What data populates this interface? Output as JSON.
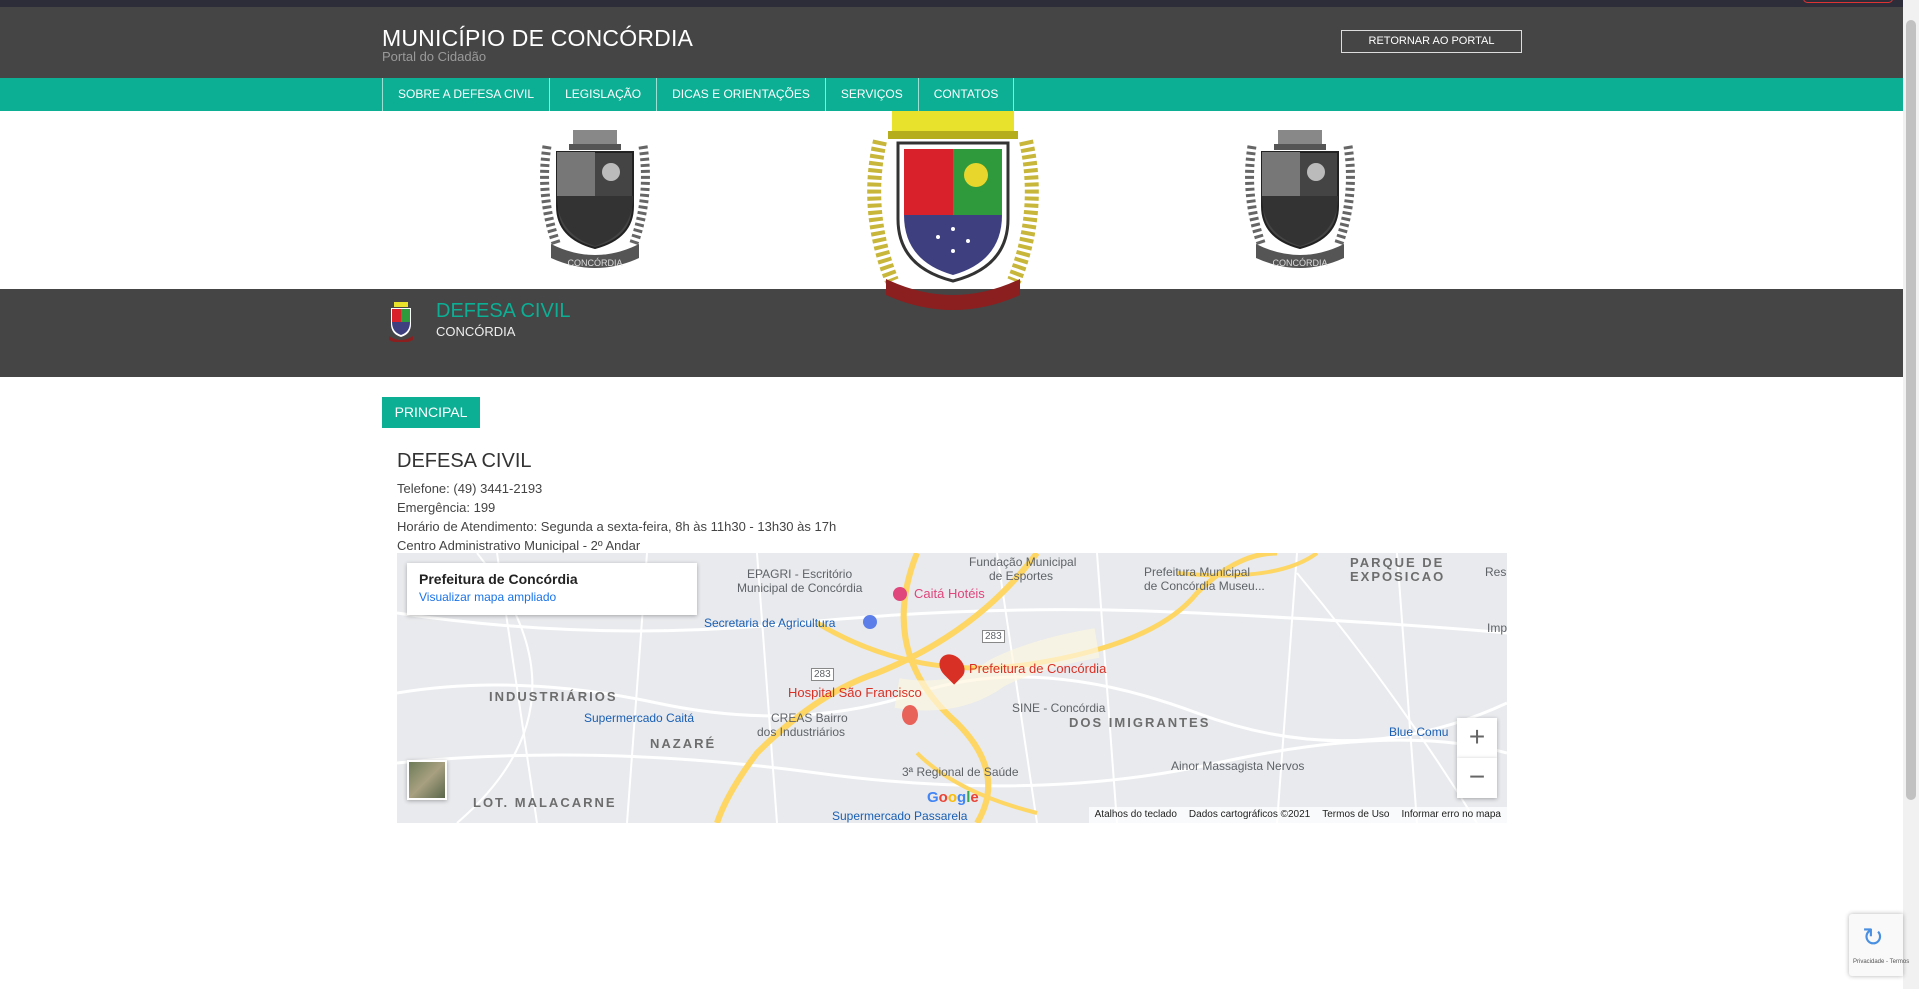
{
  "header": {
    "title": "MUNICÍPIO DE CONCÓRDIA",
    "subtitle": "Portal do Cidadão",
    "return_button": "RETORNAR AO PORTAL"
  },
  "nav": {
    "items": [
      {
        "label": "SOBRE A DEFESA CIVIL"
      },
      {
        "label": "LEGISLAÇÃO"
      },
      {
        "label": "DICAS E ORIENTAÇÕES"
      },
      {
        "label": "SERVIÇOS"
      },
      {
        "label": "CONTATOS"
      }
    ]
  },
  "section": {
    "title": "DEFESA CIVIL",
    "subtitle": "CONCÓRDIA"
  },
  "tab": {
    "label": "PRINCIPAL"
  },
  "content": {
    "heading": "DEFESA CIVIL",
    "lines": [
      "Telefone: (49) 3441-2193",
      "Emergência: 199",
      "Horário de Atendimento: Segunda a sexta-feira, 8h às 11h30 - 13h30 às 17h",
      "Centro Administrativo Municipal - 2º Andar"
    ]
  },
  "map": {
    "card_title": "Prefeitura de Concórdia",
    "card_link": "Visualizar mapa ampliado",
    "zoom_in": "+",
    "zoom_out": "−",
    "google": "Google",
    "footer": [
      "Atalhos do teclado",
      "Dados cartográficos ©2021",
      "Termos de Uso",
      "Informar erro no mapa"
    ],
    "labels": {
      "epagri": "EPAGRI - Escritório",
      "epagri2": "Municipal de Concórdia",
      "fundacao": "Fundação Municipal",
      "fundacao2": "de Esportes",
      "prefeitura_museu": "Prefeitura Municipal",
      "prefeitura_museu2": "de Concórdia Museu...",
      "parque": "PARQUE DE",
      "parque2": "EXPOSICAO",
      "res": "Res",
      "imp": "Imp",
      "caita_hoteis": "Caitá Hotéis",
      "secretaria": "Secretaria de Agricultura",
      "prefeitura": "Prefeitura de Concórdia",
      "hospital": "Hospital São Francisco",
      "industriarios": "INDUSTRIÁRIOS",
      "supermercado_caita": "Supermercado Caitá",
      "creas": "CREAS Bairro",
      "creas2": "dos Industriários",
      "sine": "SINE - Concórdia",
      "imigrantes": "DOS IMIGRANTES",
      "nazare": "NAZARÉ",
      "regional": "3ª Regional de Saúde",
      "ainor": "Ainor Massagista Nervos",
      "blue": "Blue Comu",
      "malacarne": "LOT. MALACARNE",
      "passarela": "Supermercado Passarela",
      "road283a": "283",
      "road283b": "283"
    }
  },
  "recaptcha": {
    "text": "Privacidade - Termos"
  },
  "colors": {
    "header_bg": "#454545",
    "accent": "#0cae94",
    "map_pin": "#d93025"
  }
}
